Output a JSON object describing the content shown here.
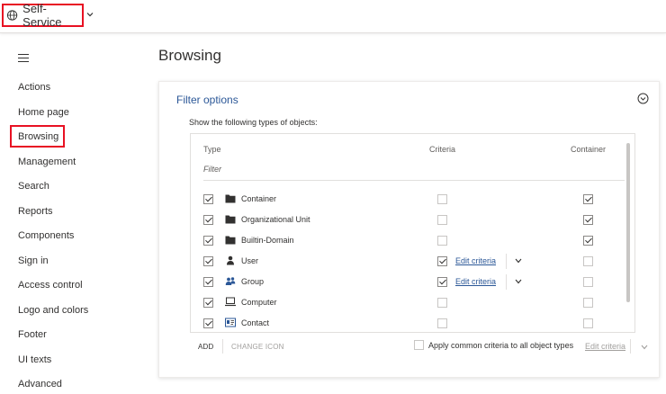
{
  "header": {
    "app_name": "Self-Service",
    "icon": "globe-icon"
  },
  "page": {
    "title": "Browsing"
  },
  "nav": {
    "items": [
      {
        "label": "Actions"
      },
      {
        "label": "Home page"
      },
      {
        "label": "Browsing",
        "active": true
      },
      {
        "label": "Management"
      },
      {
        "label": "Search"
      },
      {
        "label": "Reports"
      },
      {
        "label": "Components"
      },
      {
        "label": "Sign in"
      },
      {
        "label": "Access control"
      },
      {
        "label": "Logo and colors"
      },
      {
        "label": "Footer"
      },
      {
        "label": "UI texts"
      },
      {
        "label": "Advanced"
      }
    ]
  },
  "filter_options": {
    "title": "Filter options",
    "subtitle": "Show the following types of objects:",
    "columns": {
      "type": "Type",
      "criteria": "Criteria",
      "container": "Container"
    },
    "filter_placeholder": "Filter",
    "rows": [
      {
        "label": "Container",
        "icon": "folder-icon",
        "selected": true,
        "criteria": false,
        "edit_criteria": "",
        "container": true
      },
      {
        "label": "Organizational Unit",
        "icon": "folder-icon",
        "selected": true,
        "criteria": false,
        "edit_criteria": "",
        "container": true
      },
      {
        "label": "Builtin-Domain",
        "icon": "folder-icon",
        "selected": true,
        "criteria": false,
        "edit_criteria": "",
        "container": true
      },
      {
        "label": "User",
        "icon": "user-icon",
        "selected": true,
        "criteria": true,
        "edit_criteria": "Edit criteria",
        "container": false
      },
      {
        "label": "Group",
        "icon": "group-icon",
        "selected": true,
        "criteria": true,
        "edit_criteria": "Edit criteria",
        "container": false
      },
      {
        "label": "Computer",
        "icon": "computer-icon",
        "selected": true,
        "criteria": false,
        "edit_criteria": "",
        "container": false
      },
      {
        "label": "Contact",
        "icon": "contact-card-icon",
        "selected": true,
        "criteria": false,
        "edit_criteria": "",
        "container": false
      }
    ],
    "footer": {
      "add": "ADD",
      "change_icon": "CHANGE ICON",
      "apply_common": "Apply common criteria to all object types",
      "edit_criteria": "Edit criteria"
    }
  },
  "colors": {
    "highlight": "#e81123",
    "link": "#2b5797",
    "text": "#323130"
  }
}
